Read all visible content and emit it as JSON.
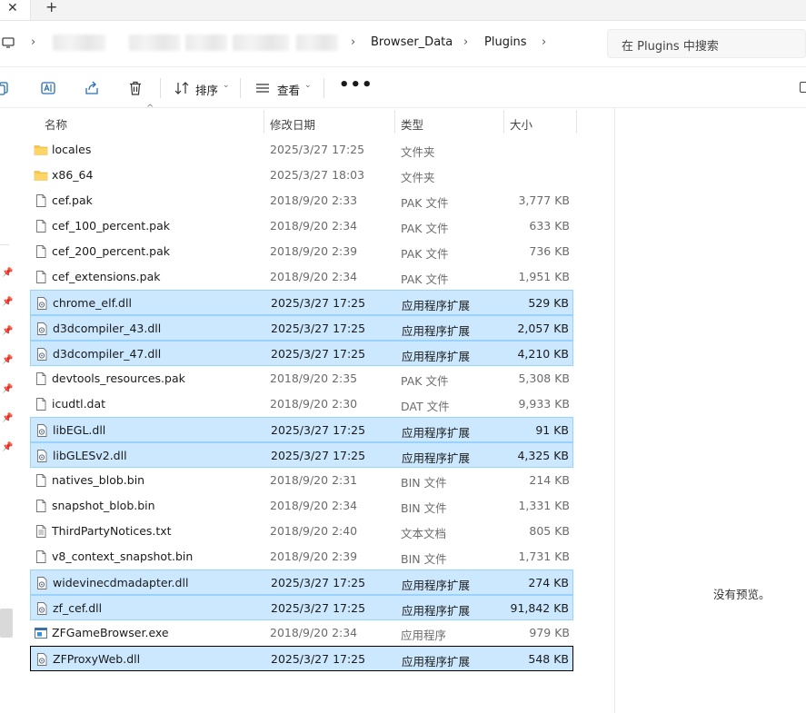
{
  "tabs": {
    "close_glyph": "✕",
    "new_tab_glyph": "+"
  },
  "breadcrumb": {
    "items": [
      "Browser_Data",
      "Plugins"
    ]
  },
  "search": {
    "placeholder": "在 Plugins 中搜索"
  },
  "toolbar": {
    "sort_label": "排序",
    "view_label": "查看",
    "more_label": "•••"
  },
  "columns": {
    "name": "名称",
    "date": "修改日期",
    "type": "类型",
    "size": "大小"
  },
  "files": [
    {
      "name": "locales",
      "date": "2025/3/27 17:25",
      "type": "文件夹",
      "size": "",
      "icon": "folder-icon",
      "selected": false
    },
    {
      "name": "x86_64",
      "date": "2025/3/27 18:03",
      "type": "文件夹",
      "size": "",
      "icon": "folder-icon",
      "selected": false
    },
    {
      "name": "cef.pak",
      "date": "2018/9/20 2:33",
      "type": "PAK 文件",
      "size": "3,777 KB",
      "icon": "file-icon",
      "selected": false
    },
    {
      "name": "cef_100_percent.pak",
      "date": "2018/9/20 2:34",
      "type": "PAK 文件",
      "size": "633 KB",
      "icon": "file-icon",
      "selected": false
    },
    {
      "name": "cef_200_percent.pak",
      "date": "2018/9/20 2:39",
      "type": "PAK 文件",
      "size": "736 KB",
      "icon": "file-icon",
      "selected": false
    },
    {
      "name": "cef_extensions.pak",
      "date": "2018/9/20 2:34",
      "type": "PAK 文件",
      "size": "1,951 KB",
      "icon": "file-icon",
      "selected": false
    },
    {
      "name": "chrome_elf.dll",
      "date": "2025/3/27 17:25",
      "type": "应用程序扩展",
      "size": "529 KB",
      "icon": "dll-icon",
      "selected": true
    },
    {
      "name": "d3dcompiler_43.dll",
      "date": "2025/3/27 17:25",
      "type": "应用程序扩展",
      "size": "2,057 KB",
      "icon": "dll-icon",
      "selected": true
    },
    {
      "name": "d3dcompiler_47.dll",
      "date": "2025/3/27 17:25",
      "type": "应用程序扩展",
      "size": "4,210 KB",
      "icon": "dll-icon",
      "selected": true
    },
    {
      "name": "devtools_resources.pak",
      "date": "2018/9/20 2:35",
      "type": "PAK 文件",
      "size": "5,308 KB",
      "icon": "file-icon",
      "selected": false
    },
    {
      "name": "icudtl.dat",
      "date": "2018/9/20 2:30",
      "type": "DAT 文件",
      "size": "9,933 KB",
      "icon": "file-icon",
      "selected": false
    },
    {
      "name": "libEGL.dll",
      "date": "2025/3/27 17:25",
      "type": "应用程序扩展",
      "size": "91 KB",
      "icon": "dll-icon",
      "selected": true
    },
    {
      "name": "libGLESv2.dll",
      "date": "2025/3/27 17:25",
      "type": "应用程序扩展",
      "size": "4,325 KB",
      "icon": "dll-icon",
      "selected": true
    },
    {
      "name": "natives_blob.bin",
      "date": "2018/9/20 2:31",
      "type": "BIN 文件",
      "size": "214 KB",
      "icon": "file-icon",
      "selected": false
    },
    {
      "name": "snapshot_blob.bin",
      "date": "2018/9/20 2:34",
      "type": "BIN 文件",
      "size": "1,331 KB",
      "icon": "file-icon",
      "selected": false
    },
    {
      "name": "ThirdPartyNotices.txt",
      "date": "2018/9/20 2:40",
      "type": "文本文档",
      "size": "805 KB",
      "icon": "text-file-icon",
      "selected": false
    },
    {
      "name": "v8_context_snapshot.bin",
      "date": "2018/9/20 2:39",
      "type": "BIN 文件",
      "size": "1,731 KB",
      "icon": "file-icon",
      "selected": false
    },
    {
      "name": "widevinecdmadapter.dll",
      "date": "2025/3/27 17:25",
      "type": "应用程序扩展",
      "size": "274 KB",
      "icon": "dll-icon",
      "selected": true
    },
    {
      "name": "zf_cef.dll",
      "date": "2025/3/27 17:25",
      "type": "应用程序扩展",
      "size": "91,842 KB",
      "icon": "dll-icon",
      "selected": true
    },
    {
      "name": "ZFGameBrowser.exe",
      "date": "2018/9/20 2:34",
      "type": "应用程序",
      "size": "979 KB",
      "icon": "exe-icon",
      "selected": false
    },
    {
      "name": "ZFProxyWeb.dll",
      "date": "2025/3/27 17:25",
      "type": "应用程序扩展",
      "size": "548 KB",
      "icon": "dll-icon",
      "selected": true,
      "focused": true
    }
  ],
  "preview": {
    "empty_text": "没有预览。"
  },
  "colors": {
    "selection_bg": "#cce8ff",
    "selection_border": "#99d1ff",
    "folder": "#f8c94a"
  }
}
